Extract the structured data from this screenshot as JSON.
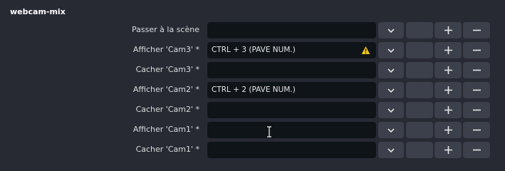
{
  "group": {
    "title": "webcam-mix"
  },
  "rows": [
    {
      "label": "Passer à la scène",
      "hotkey": "",
      "warning": false
    },
    {
      "label": "Afficher 'Cam3' *",
      "hotkey": "CTRL + 3 (PAVE NUM.)",
      "warning": true
    },
    {
      "label": "Cacher 'Cam3' *",
      "hotkey": "",
      "warning": false
    },
    {
      "label": "Afficher 'Cam2' *",
      "hotkey": "CTRL + 2 (PAVE NUM.)",
      "warning": false
    },
    {
      "label": "Cacher 'Cam2' *",
      "hotkey": "",
      "warning": false
    },
    {
      "label": "Afficher 'Cam1' *",
      "hotkey": "",
      "warning": false
    },
    {
      "label": "Cacher 'Cam1' *",
      "hotkey": "",
      "warning": false
    }
  ],
  "icons": {
    "dropdown": "chevron-down-icon",
    "add": "plus-icon",
    "remove": "minus-icon",
    "warning": "warning-icon",
    "cursor": "text-cursor-icon"
  },
  "colors": {
    "background": "#272a33",
    "field": "#0f1419",
    "button": "#3c404b",
    "warning": "#f0c419"
  }
}
